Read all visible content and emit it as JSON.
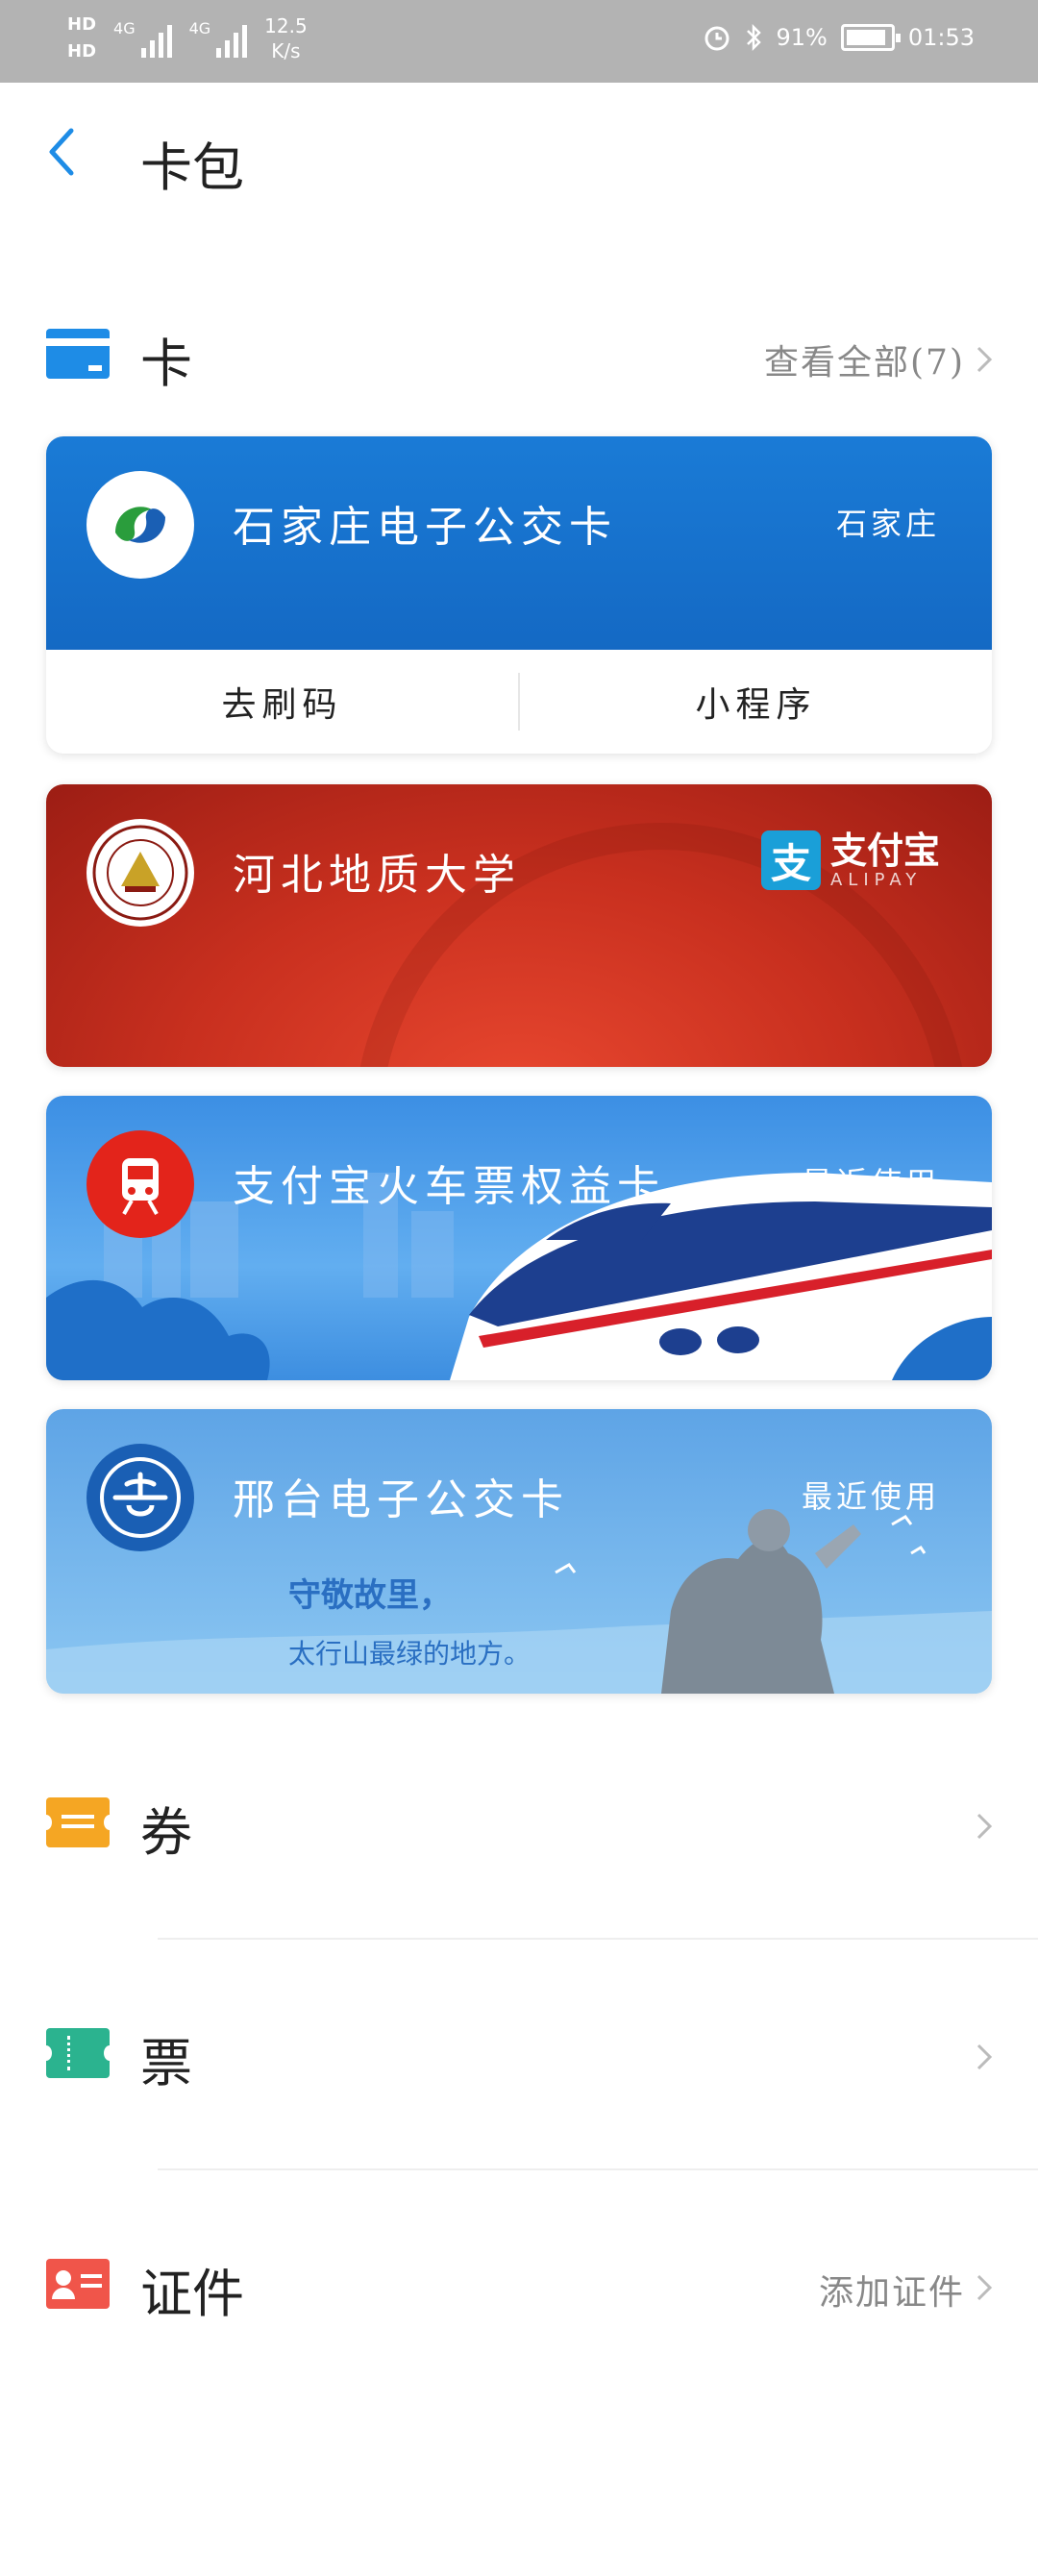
{
  "status_bar": {
    "hd1": "HD",
    "hd2": "HD",
    "net1": "4G",
    "net2": "4G",
    "speed_value": "12.5",
    "speed_unit": "K/s",
    "battery": "91%",
    "battery_level": 0.91,
    "time": "01:53"
  },
  "header": {
    "title": "卡包"
  },
  "cards_section": {
    "title": "卡",
    "view_all": "查看全部(7)",
    "icon_color": "#1e8ce6"
  },
  "cards": [
    {
      "name": "石家庄电子公交卡",
      "tag": "石家庄",
      "actions": [
        "去刷码",
        "小程序"
      ]
    },
    {
      "name": "河北地质大学",
      "badge": "支付宝",
      "badge_sub": "ALIPAY"
    },
    {
      "name": "支付宝火车票权益卡",
      "tag": "最近使用"
    },
    {
      "name": "邢台电子公交卡",
      "tag": "最近使用",
      "slogan_line1": "守敬故里，",
      "slogan_line2": "太行山最绿的地方。"
    }
  ],
  "sections": [
    {
      "title": "券",
      "right": "",
      "icon_color": "#f5a623"
    },
    {
      "title": "票",
      "right": "",
      "icon_color": "#2bb38f"
    },
    {
      "title": "证件",
      "right": "添加证件",
      "icon_color": "#f0554a"
    }
  ]
}
